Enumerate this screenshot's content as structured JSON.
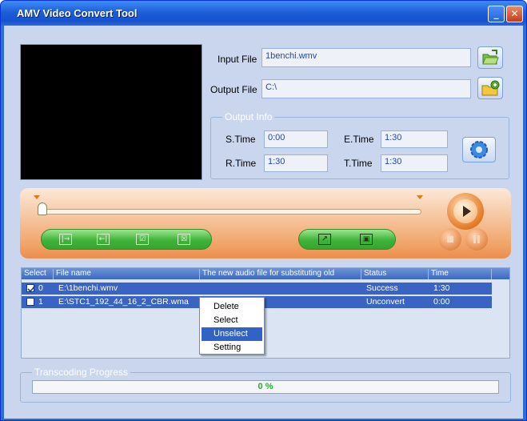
{
  "window": {
    "title": "AMV Video Convert Tool",
    "minimize_glyph": "_",
    "close_glyph": "✕"
  },
  "input": {
    "label": "Input File",
    "value": "1benchi.wmv",
    "browse_icon": "open-folder-icon"
  },
  "output": {
    "label": "Output File",
    "value": "C:\\",
    "browse_icon": "save-folder-icon"
  },
  "output_info": {
    "legend": "Output Info",
    "s_time_label": "S.Time",
    "s_time": "0:00",
    "e_time_label": "E.Time",
    "e_time": "1:30",
    "r_time_label": "R.Time",
    "r_time": "1:30",
    "t_time_label": "T.Time",
    "t_time": "1:30",
    "settings_icon": "gear-icon"
  },
  "player": {
    "slider_position": 0,
    "buttons": {
      "mark_in": "|→",
      "mark_out": "←|",
      "select_all": "☑",
      "unselect_all": "☒",
      "convert": "↗",
      "stop": "▣"
    }
  },
  "table": {
    "columns": [
      "Select",
      "File name",
      "The new audio file for substituting old",
      "Status",
      "Time"
    ],
    "rows": [
      {
        "checked": true,
        "index": "0",
        "file": "E:\\1benchi.wmv",
        "audio": "",
        "status": "Success",
        "time": "1:30"
      },
      {
        "checked": false,
        "index": "1",
        "file": "E:\\STC1_192_44_16_2_CBR.wma",
        "audio": "",
        "status": "Unconvert",
        "time": "0:00"
      }
    ]
  },
  "context_menu": {
    "items": [
      "Delete",
      "Select",
      "Unselect",
      "Setting"
    ],
    "highlighted": "Unselect"
  },
  "progress": {
    "legend": "Transcoding Progress",
    "value_percent": 0,
    "text": "0 %"
  },
  "colors": {
    "row_selected": "#3a64c4",
    "menu_highlight": "#3163c5",
    "progress_text": "#20b020"
  }
}
